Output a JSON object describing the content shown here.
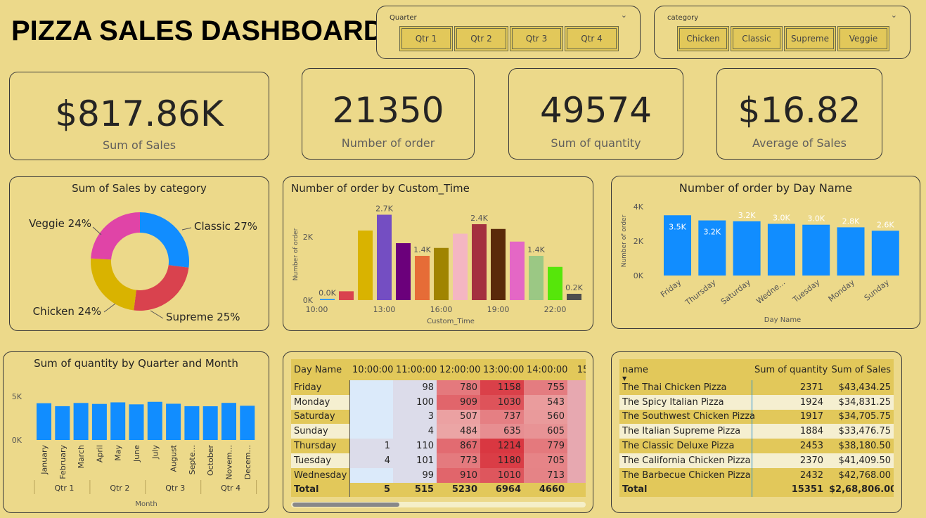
{
  "title": "PIZZA SALES DASHBOARD",
  "slicers": {
    "quarter": {
      "label": "Quarter",
      "options": [
        "Qtr 1",
        "Qtr 2",
        "Qtr 3",
        "Qtr 4"
      ]
    },
    "category": {
      "label": "category",
      "options": [
        "Chicken",
        "Classic",
        "Supreme",
        "Veggie"
      ]
    }
  },
  "kpis": [
    {
      "value": "$817.86K",
      "label": "Sum of Sales"
    },
    {
      "value": "21350",
      "label": "Number of order"
    },
    {
      "value": "49574",
      "label": "Sum of quantity"
    },
    {
      "value": "$16.82",
      "label": "Average of Sales"
    }
  ],
  "colors": {
    "background": "#ecd98a",
    "bar_blue": "#118dff",
    "border": "#3a3a3a"
  },
  "charts": {
    "donut": {
      "title": "Sum of Sales by category",
      "chart_data": {
        "type": "pie",
        "slices": [
          {
            "name": "Classic",
            "value": 27,
            "label": "Classic 27%",
            "color": "#118dff"
          },
          {
            "name": "Supreme",
            "value": 25,
            "label": "Supreme 25%",
            "color": "#d9424e"
          },
          {
            "name": "Chicken",
            "value": 24,
            "label": "Chicken 24%",
            "color": "#d9b300"
          },
          {
            "name": "Veggie",
            "value": 24,
            "label": "Veggie 24%",
            "color": "#e044a7"
          }
        ]
      }
    },
    "custom_time": {
      "title": "Number of order by Custom_Time",
      "chart_data": {
        "type": "bar",
        "xlabel": "Custom_Time",
        "ylabel": "Number of order",
        "ylim": [
          0,
          3000
        ],
        "y_ticks": [
          "0K",
          "2K"
        ],
        "x_ticks": [
          "10:00",
          "13:00",
          "16:00",
          "19:00",
          "22:00"
        ],
        "values": [
          10,
          280,
          2200,
          2700,
          1800,
          1400,
          1650,
          2100,
          2400,
          2250,
          1850,
          1400,
          1050,
          200
        ],
        "colors": [
          "#118dff",
          "#d9424e",
          "#d9b300",
          "#744ec2",
          "#6b007b",
          "#e66c37",
          "#a08400",
          "#f4b6c2",
          "#a4303f",
          "#5a2a0a",
          "#e467c5",
          "#9bc884",
          "#56e60a",
          "#4d4d4d"
        ],
        "data_labels": [
          {
            "index": 0,
            "text": "0.0K"
          },
          {
            "index": 3,
            "text": "2.7K"
          },
          {
            "index": 5,
            "text": "1.4K"
          },
          {
            "index": 8,
            "text": "2.4K"
          },
          {
            "index": 11,
            "text": "1.4K"
          },
          {
            "index": 13,
            "text": "0.2K"
          }
        ]
      }
    },
    "day_name": {
      "title": "Number of order by Day Name",
      "chart_data": {
        "type": "bar",
        "xlabel": "Day Name",
        "ylabel": "Number of order",
        "ylim": [
          0,
          4000
        ],
        "y_ticks": [
          "0K",
          "2K",
          "4K"
        ],
        "categories": [
          "Friday",
          "Thursday",
          "Saturday",
          "Wedne...",
          "Tuesday",
          "Monday",
          "Sunday"
        ],
        "values": [
          3500,
          3200,
          3150,
          3000,
          2950,
          2800,
          2600
        ],
        "labels": [
          "3.5K",
          "3.2K",
          "3.2K",
          "3.0K",
          "3.0K",
          "2.8K",
          "2.6K"
        ]
      }
    },
    "quarter_month": {
      "title": "Sum of quantity by Quarter and Month",
      "chart_data": {
        "type": "bar",
        "xlabel": "Month",
        "ylim": [
          0,
          5500
        ],
        "y_ticks": [
          "0K",
          "5K"
        ],
        "categories": [
          "January",
          "February",
          "March",
          "April",
          "May",
          "June",
          "July",
          "August",
          "Septe...",
          "October",
          "Novem...",
          "Decem..."
        ],
        "groups": [
          "Qtr 1",
          "Qtr 2",
          "Qtr 3",
          "Qtr 4"
        ],
        "values": [
          4230,
          3890,
          4260,
          4150,
          4330,
          4100,
          4390,
          4170,
          3890,
          3880,
          4270,
          3940
        ]
      }
    }
  },
  "matrix": {
    "headers": [
      "Day Name",
      "10:00:00",
      "11:00:00",
      "12:00:00",
      "13:00:00",
      "14:00:00",
      "15:0"
    ],
    "rows": [
      [
        "Friday",
        "",
        "98",
        "780",
        "1158",
        "755",
        ""
      ],
      [
        "Monday",
        "",
        "100",
        "909",
        "1030",
        "543",
        ""
      ],
      [
        "Saturday",
        "",
        "3",
        "507",
        "737",
        "560",
        ""
      ],
      [
        "Sunday",
        "",
        "4",
        "484",
        "635",
        "605",
        ""
      ],
      [
        "Thursday",
        "1",
        "110",
        "867",
        "1214",
        "779",
        ""
      ],
      [
        "Tuesday",
        "4",
        "101",
        "773",
        "1180",
        "705",
        ""
      ],
      [
        "Wednesday",
        "",
        "99",
        "910",
        "1010",
        "713",
        ""
      ]
    ],
    "total": [
      "Total",
      "5",
      "515",
      "5230",
      "6964",
      "4660",
      ""
    ]
  },
  "pizza_table": {
    "headers": [
      "name",
      "Sum of quantity",
      "Sum of Sales"
    ],
    "rows": [
      [
        "The Thai Chicken Pizza",
        "2371",
        "$43,434.25"
      ],
      [
        "The Spicy Italian Pizza",
        "1924",
        "$34,831.25"
      ],
      [
        "The Southwest Chicken Pizza",
        "1917",
        "$34,705.75"
      ],
      [
        "The Italian Supreme Pizza",
        "1884",
        "$33,476.75"
      ],
      [
        "The Classic Deluxe Pizza",
        "2453",
        "$38,180.50"
      ],
      [
        "The California Chicken Pizza",
        "2370",
        "$41,409.50"
      ],
      [
        "The Barbecue Chicken Pizza",
        "2432",
        "$42,768.00"
      ]
    ],
    "total": [
      "Total",
      "15351",
      "$2,68,806.00"
    ]
  }
}
